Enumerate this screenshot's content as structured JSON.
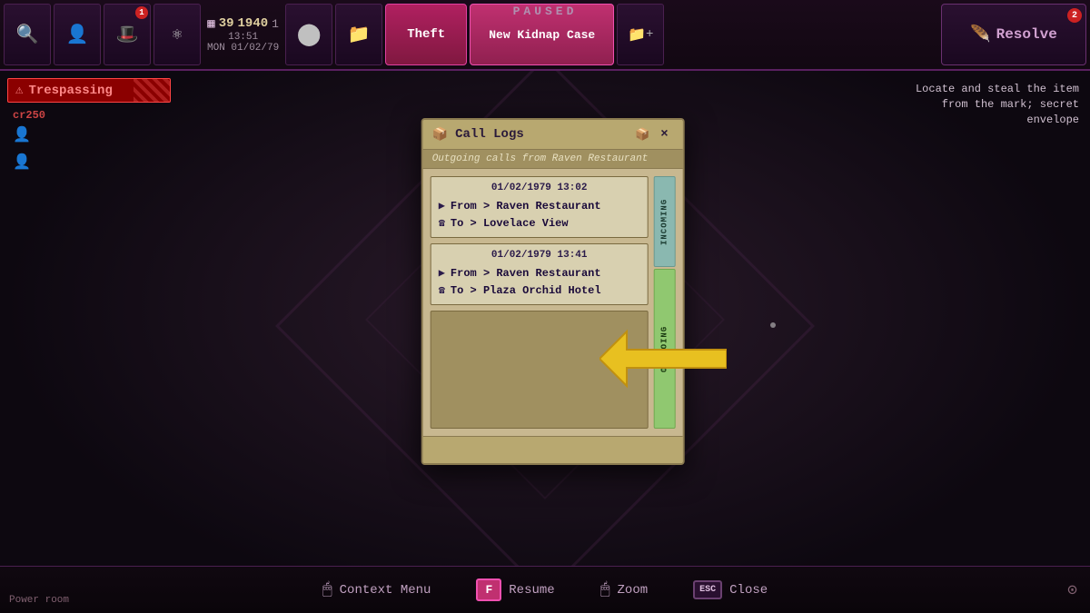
{
  "game": {
    "paused_label": "PAUSED",
    "power_room_label": "Power room"
  },
  "hud": {
    "stats": {
      "money": "39",
      "year": "1940",
      "plus": "1",
      "time": "13:51",
      "date": "MON 01/02/79"
    },
    "tabs": {
      "theft_label": "Theft",
      "kidnap_label": "New Kidnap Case",
      "new_case_label": "+"
    },
    "resolve_label": "Resolve",
    "badge1": "1",
    "badge2": "2"
  },
  "trespassing": {
    "label": "Trespassing",
    "cr_label": "cr250"
  },
  "mission_text": "Locate and steal the item from the mark; secret envelope",
  "call_logs": {
    "title": "Call Logs",
    "subtitle": "Outgoing calls from Raven Restaurant",
    "close_label": "×",
    "incoming_tab": "INCOMING",
    "outgoing_tab": "OUTGOING",
    "calls": [
      {
        "timestamp": "01/02/1979 13:02",
        "from": "From > Raven Restaurant",
        "to": "To > Lovelace View"
      },
      {
        "timestamp": "01/02/1979 13:41",
        "from": "From > Raven Restaurant",
        "to": "To > Plaza Orchid Hotel"
      }
    ]
  },
  "bottom_bar": {
    "context_menu_icon": "🖱",
    "context_menu_label": "Context Menu",
    "resume_key": "F",
    "resume_label": "Resume",
    "zoom_icon": "🖱",
    "zoom_label": "Zoom",
    "close_key": "ESC",
    "close_label": "Close"
  },
  "icons": {
    "magnifier": "🔍",
    "person": "👤",
    "hat": "🎩",
    "dna": "⚛",
    "bars": "▦",
    "folder": "📁",
    "feather": "🪶",
    "circle": "⬤",
    "phone": "☎",
    "play": "▶",
    "box": "⬜",
    "alert": "⚠",
    "cursor": "↖"
  }
}
